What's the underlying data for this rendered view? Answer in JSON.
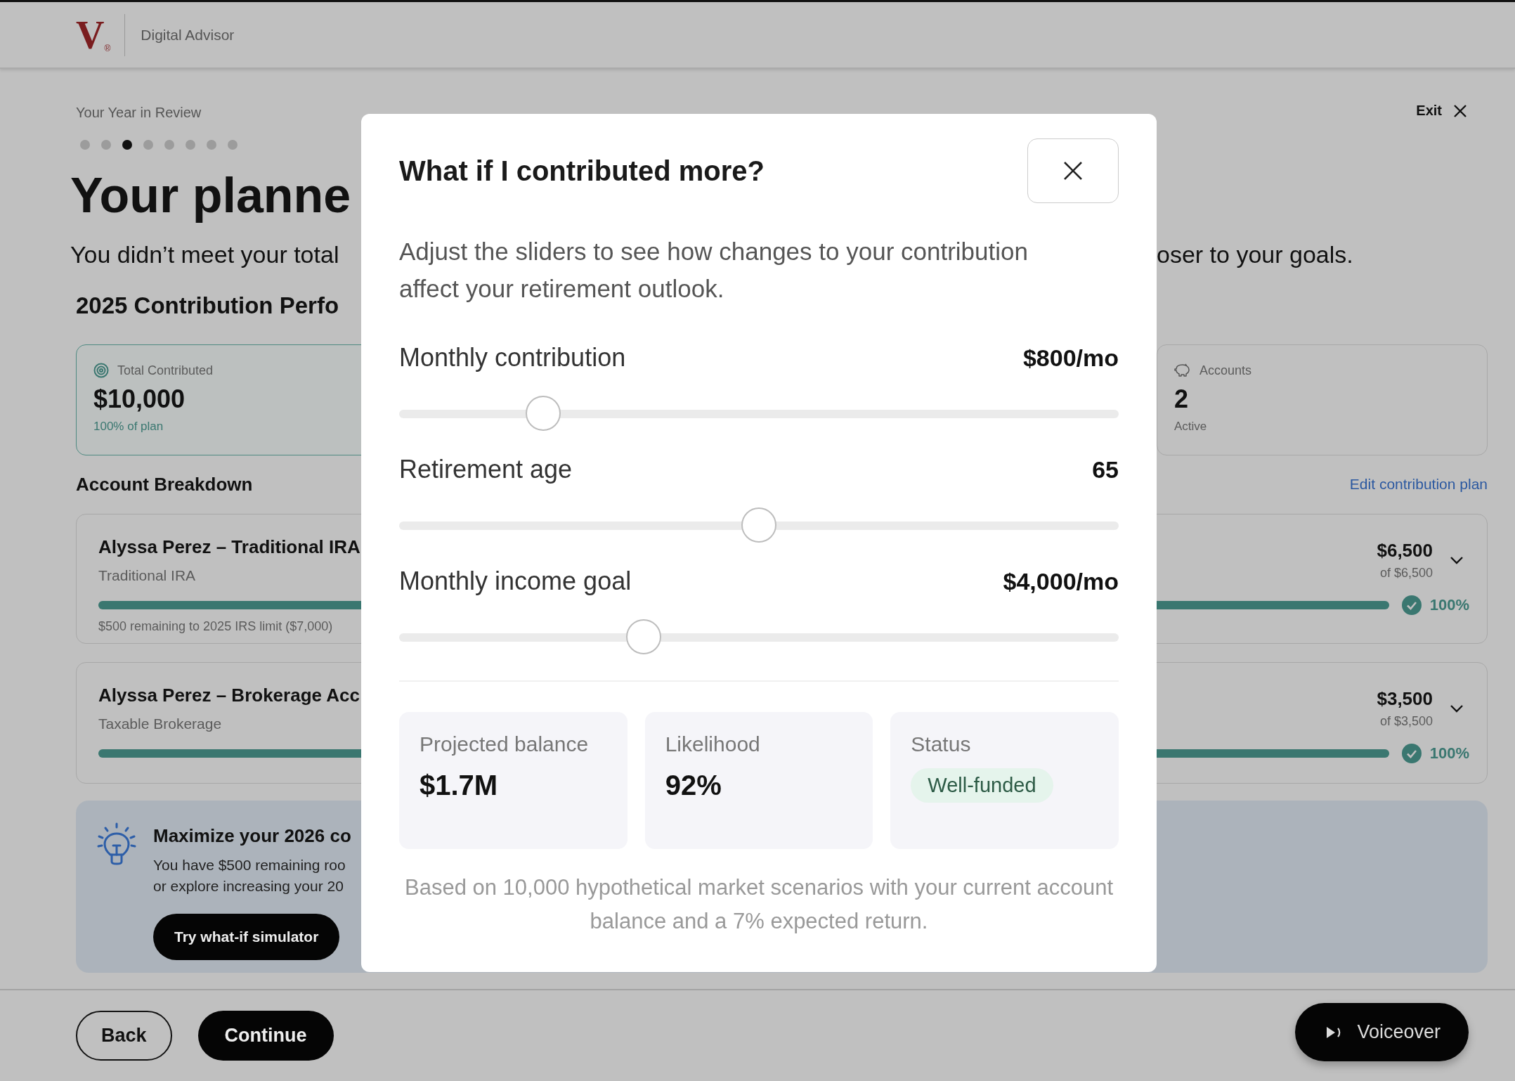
{
  "header": {
    "logo_letter": "V",
    "logo_mark": "®",
    "product": "Digital Advisor"
  },
  "eyebrow": "Your Year in Review",
  "exit": "Exit",
  "steps": [
    {
      "selected": false
    },
    {
      "selected": false
    },
    {
      "selected": true
    },
    {
      "selected": false
    },
    {
      "selected": false
    },
    {
      "selected": false
    },
    {
      "selected": false
    },
    {
      "selected": false
    }
  ],
  "headline": "Your planne",
  "subtitle_left": "You didn’t meet your total",
  "subtitle_right": "oser to your goals.",
  "section_title": "2025 Contribution Perfo",
  "stats": [
    {
      "kind": "total",
      "label": "Total Contributed",
      "value": "$10,000",
      "note": "100% of plan"
    },
    {
      "kind": "count",
      "label": "Accounts",
      "value": "2",
      "note": "Active"
    }
  ],
  "breakdown_title": "Account Breakdown",
  "edit_link": "Edit contribution plan",
  "accounts": [
    {
      "name": "Alyssa Perez – Traditional IRA",
      "type": "Traditional IRA",
      "amount": "$6,500",
      "target": "of $6,500",
      "level": 1,
      "percent": "100%",
      "note": "$500 remaining to 2025 IRS limit ($7,000)"
    },
    {
      "name": "Alyssa Perez – Brokerage Acc",
      "type": "Taxable Brokerage",
      "amount": "$3,500",
      "target": "of $3,500",
      "level": 1,
      "percent": "100%"
    }
  ],
  "tip": {
    "title": "Maximize your 2026 co",
    "lines": [
      "You have $500 remaining roo",
      "or explore increasing your 20"
    ],
    "button": "Try what-if simulator"
  },
  "footer": {
    "back": "Back",
    "continue": "Continue",
    "voiceover": "Voiceover"
  },
  "modal": {
    "title": "What if I contributed more?",
    "description": "Adjust the sliders to see how changes to your contribution affect your retirement outlook.",
    "sliders": [
      {
        "label": "Monthly contribution",
        "value": "$800/mo",
        "level": 0.2
      },
      {
        "label": "Retirement age",
        "value": "65",
        "level": 0.5
      },
      {
        "label": "Monthly income goal",
        "value": "$4,000/mo",
        "level": 0.34
      }
    ],
    "metrics": [
      {
        "kind": "value",
        "label": "Projected balance",
        "value": "$1.7M"
      },
      {
        "kind": "value",
        "label": "Likelihood",
        "value": "92%"
      },
      {
        "kind": "badge",
        "label": "Status",
        "value": "Well-funded"
      }
    ],
    "footnote": "Based on 10,000 hypothetical market scenarios with your current account balance and a 7% expected return."
  }
}
